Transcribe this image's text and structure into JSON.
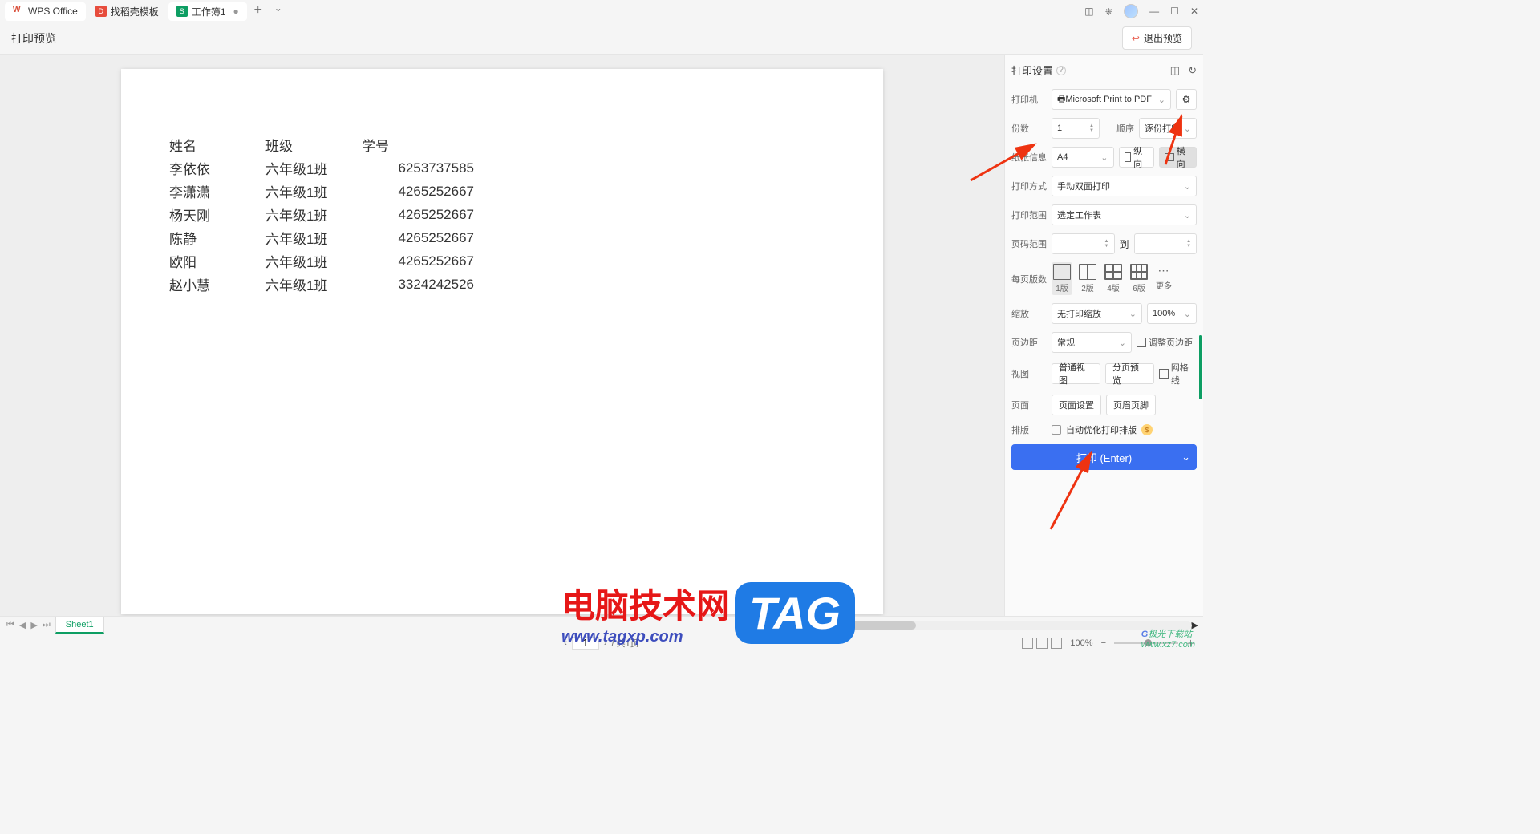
{
  "tabs": {
    "home": "WPS Office",
    "template": "找稻壳模板",
    "workbook": "工作簿1"
  },
  "toolbar": {
    "title": "打印预览",
    "exit": "退出预览"
  },
  "sheet_data": {
    "headers": [
      "姓名",
      "班级",
      "学号"
    ],
    "rows": [
      [
        "李依依",
        "六年级1班",
        "6253737585"
      ],
      [
        "李潇潇",
        "六年级1班",
        "4265252667"
      ],
      [
        "杨天刚",
        "六年级1班",
        "4265252667"
      ],
      [
        "陈静",
        "六年级1班",
        "4265252667"
      ],
      [
        "欧阳",
        "六年级1班",
        "4265252667"
      ],
      [
        "赵小慧",
        "六年级1班",
        "3324242526"
      ]
    ]
  },
  "panel": {
    "title": "打印设置",
    "printer_label": "打印机",
    "printer_value": "Microsoft Print to PDF",
    "copies_label": "份数",
    "copies_value": "1",
    "order_label": "顺序",
    "order_value": "逐份打印",
    "paper_label": "纸张信息",
    "paper_value": "A4",
    "portrait": "纵向",
    "landscape": "横向",
    "mode_label": "打印方式",
    "mode_value": "手动双面打印",
    "range_label": "打印范围",
    "range_value": "选定工作表",
    "pgrange_label": "页码范围",
    "to": "到",
    "perpage_label": "每页版数",
    "p1": "1版",
    "p2": "2版",
    "p4": "4版",
    "p6": "6版",
    "more": "更多",
    "zoom_label": "缩放",
    "zoom_value": "无打印缩放",
    "zoom_pct": "100%",
    "margin_label": "页边距",
    "margin_value": "常规",
    "adjust_margin": "调整页边距",
    "view_label": "视图",
    "view_normal": "普通视图",
    "view_page": "分页预览",
    "gridlines": "网格线",
    "page_label": "页面",
    "page_setup": "页面设置",
    "header_footer": "页眉页脚",
    "layout_label": "排版",
    "auto_layout": "自动优化打印排版",
    "print_btn": "打印 (Enter)"
  },
  "sheetbar": {
    "sheet": "Sheet1"
  },
  "status": {
    "page_input": "1",
    "total": "/ 共1页",
    "zoom": "100%"
  },
  "watermark": {
    "main": "电脑技术网",
    "sub": "www.tagxp.com",
    "tag": "TAG",
    "dl1": "极光下载站",
    "dl2": "www.xz7.com"
  }
}
